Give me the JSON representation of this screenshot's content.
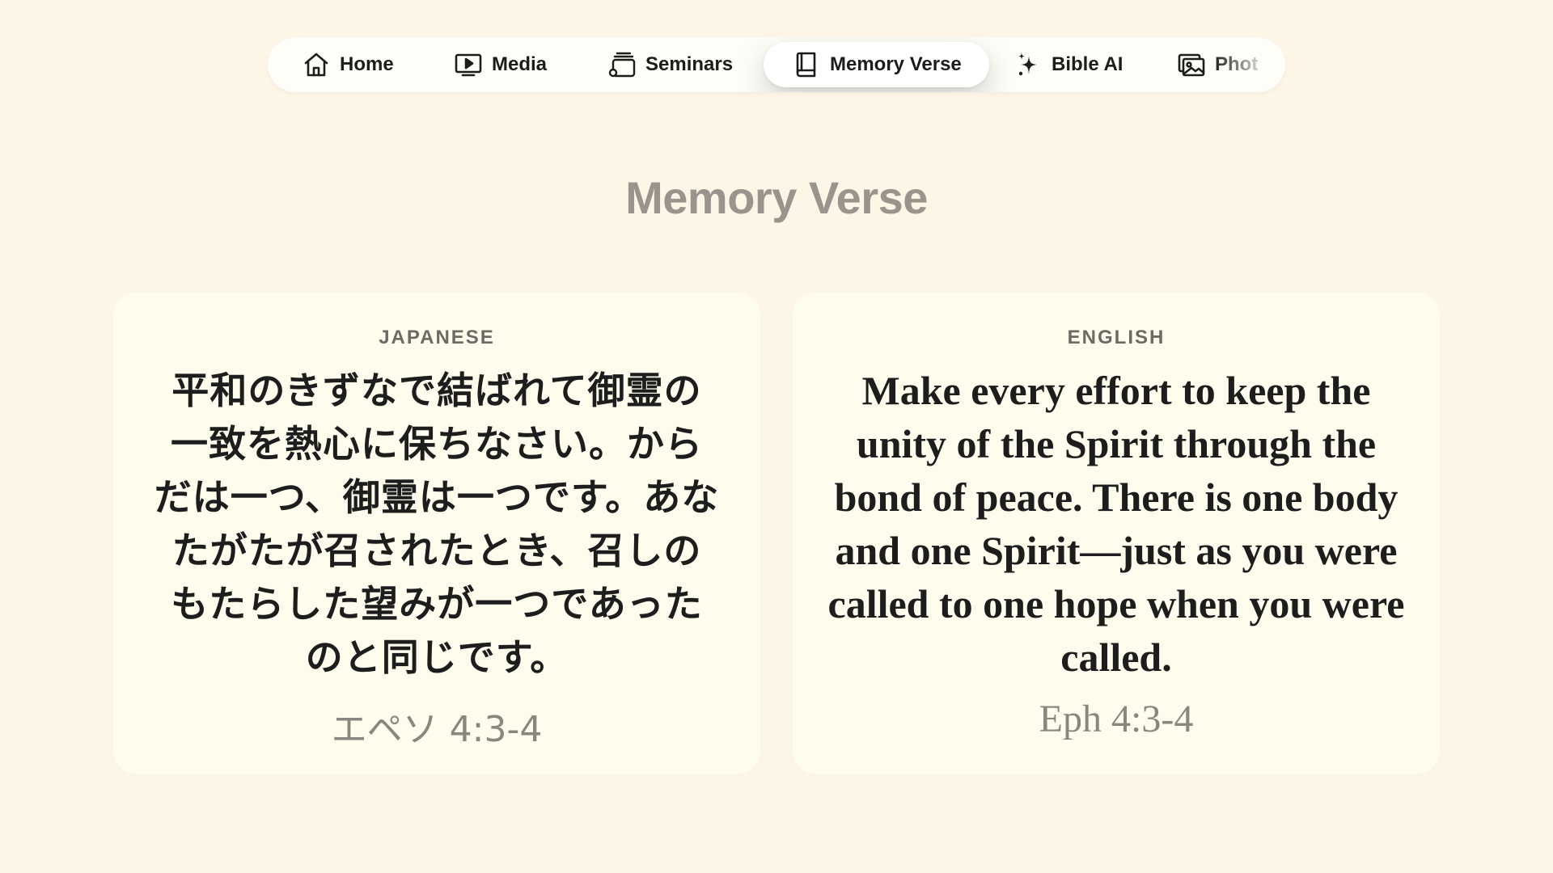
{
  "nav": {
    "items": [
      {
        "label": "Home",
        "icon": "home-icon"
      },
      {
        "label": "Media",
        "icon": "play-screen-icon"
      },
      {
        "label": "Seminars",
        "icon": "seminar-stack-icon"
      },
      {
        "label": "Memory Verse",
        "icon": "book-icon",
        "active": true
      },
      {
        "label": "Bible AI",
        "icon": "sparkle-icon"
      },
      {
        "label": "Phot",
        "icon": "photos-icon"
      }
    ]
  },
  "page_title": "Memory Verse",
  "cards": {
    "japanese": {
      "label": "JAPANESE",
      "verse": "平和のきずなで結ばれて御霊の一致を熱心に保ちなさい。からだは一つ、御霊は一つです。あなたがたが召されたとき、召しのもたらした望みが一つであったのと同じです。",
      "reference": "エペソ 4:3-4"
    },
    "english": {
      "label": "ENGLISH",
      "verse": "Make every effort to keep the unity of the Spirit through the bond of peace. There is one body and one Spirit—just as you were called to one hope when you were called.",
      "reference": "Eph 4:3-4"
    }
  },
  "colors": {
    "background": "#fdf5e6",
    "card": "#fefcec",
    "title": "#9a948c",
    "reference": "#8a857d"
  }
}
